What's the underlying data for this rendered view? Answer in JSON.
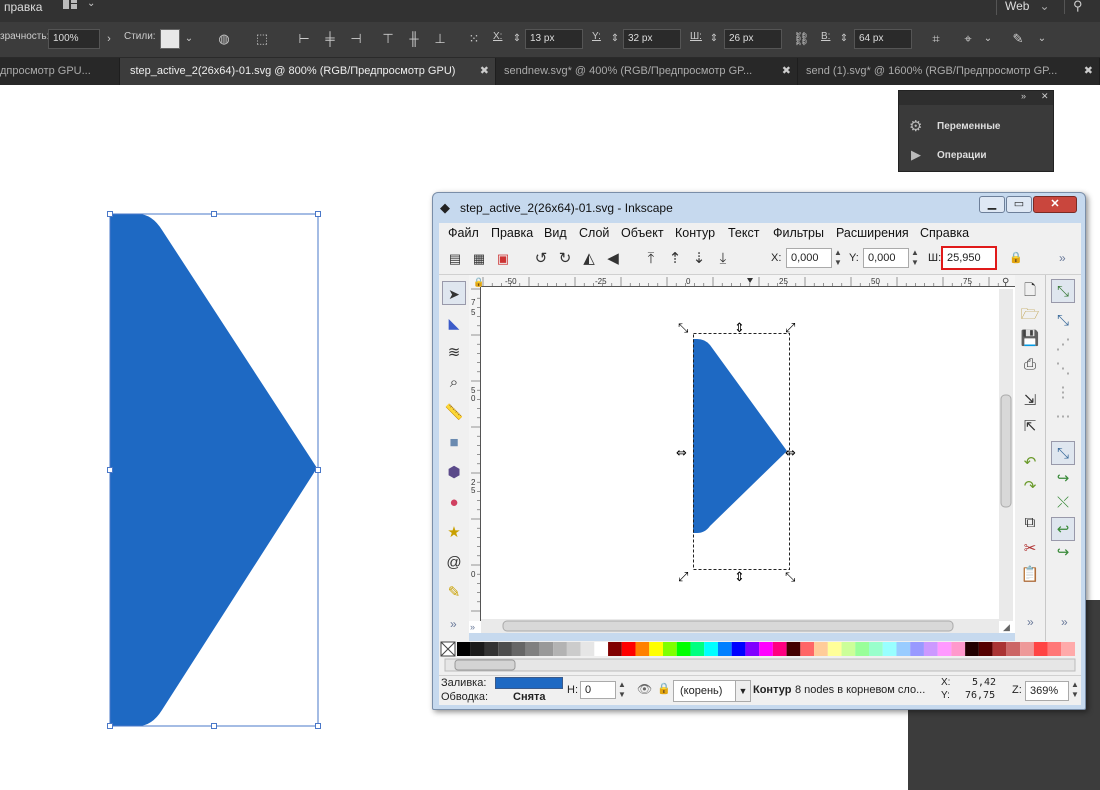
{
  "illustrator": {
    "menu": {
      "left_item": "правка",
      "workspace": "Web"
    },
    "options": {
      "opacity_label": "зрачность:",
      "opacity_value": "100%",
      "style_label": "Стили:",
      "x_label": "X:",
      "x_value": "13 px",
      "y_label": "Y:",
      "y_value": "32 px",
      "w_label": "Ш:",
      "w_value": "26 px",
      "h_label": "В:",
      "h_value": "64 px"
    },
    "tabs": [
      {
        "label": "дпросмотр GPU..."
      },
      {
        "label": "step_active_2(26x64)-01.svg @ 800% (RGB/Предпросмотр GPU)"
      },
      {
        "label": "sendnew.svg* @ 400% (RGB/Предпросмотр GP..."
      },
      {
        "label": "send (1).svg* @ 1600% (RGB/Предпросмотр GP..."
      }
    ],
    "panel": {
      "items": [
        {
          "label": "Переменные"
        },
        {
          "label": "Операции"
        }
      ]
    }
  },
  "inkscape": {
    "title": "step_active_2(26x64)-01.svg - Inkscape",
    "menu": [
      "Файл",
      "Правка",
      "Вид",
      "Слой",
      "Объект",
      "Контур",
      "Текст",
      "Фильтры",
      "Расширения",
      "Справка"
    ],
    "toolbar": {
      "x_label": "X:",
      "x_value": "0,000",
      "y_label": "Y:",
      "y_value": "0,000",
      "w_label": "Ш:",
      "w_value": "25,950",
      "more": "»"
    },
    "ruler_top": [
      "-50",
      "-25",
      "0",
      "25",
      "50",
      "75"
    ],
    "ruler_left": [
      "7",
      "5",
      "5",
      "0",
      "2",
      "5",
      "0"
    ],
    "status": {
      "fill_label": "Заливка:",
      "stroke_label": "Обводка:",
      "stroke_value": "Снята",
      "h_label": "Н:",
      "h_value": "0",
      "layer": "(корень)",
      "message_bold": "Контур",
      "message": "8 nodes в корневом сло...",
      "x_label": "X:",
      "x_value": "5,42",
      "y_label": "Y:",
      "y_value": "76,75",
      "zoom_label": "Z:",
      "zoom_value": "369%"
    },
    "toolbox_more": "»",
    "rightbar_more": "»"
  },
  "colors": {
    "shape_fill": "#1e69c3",
    "highlight": "#e01a1a",
    "selection": "#4a78c8"
  }
}
